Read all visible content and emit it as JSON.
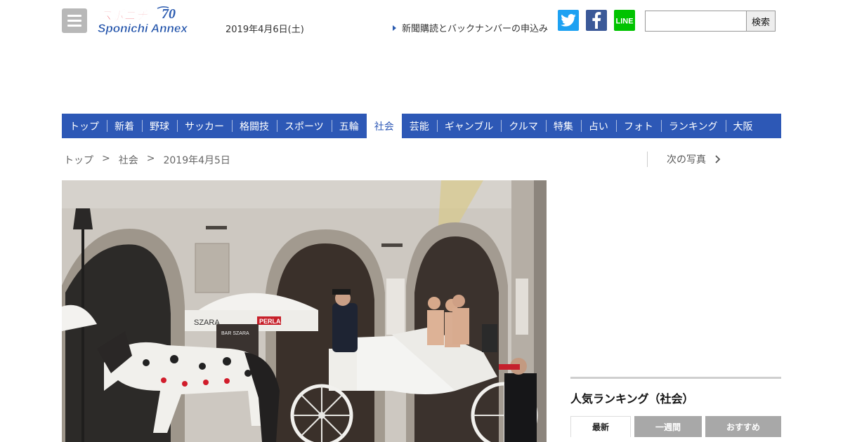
{
  "header": {
    "logo_text": "スポニチ",
    "logo_sub": "Sponichi Annex",
    "logo_anniv": "70",
    "date": "2019年4月6日(土)",
    "subscribe_link": "新聞購読とバックナンバーの申込み",
    "search_placeholder": "",
    "search_button": "検索",
    "line_label": "LINE"
  },
  "nav": [
    {
      "label": "トップ"
    },
    {
      "label": "新着"
    },
    {
      "label": "野球"
    },
    {
      "label": "サッカー"
    },
    {
      "label": "格闘技"
    },
    {
      "label": "スポーツ"
    },
    {
      "label": "五輪"
    },
    {
      "label": "社会",
      "active": true
    },
    {
      "label": "芸能"
    },
    {
      "label": "ギャンブル"
    },
    {
      "label": "クルマ"
    },
    {
      "label": "特集"
    },
    {
      "label": "占い"
    },
    {
      "label": "フォト"
    },
    {
      "label": "ランキング"
    },
    {
      "label": "大阪"
    }
  ],
  "breadcrumb": {
    "items": [
      "トップ",
      "社会",
      "2019年4月5日"
    ],
    "separator": ">"
  },
  "next_photo": "次の写真",
  "photo": {
    "signs": [
      "SZARA",
      "PERLA",
      "BAR SZARA",
      "BAR"
    ]
  },
  "ranking": {
    "title": "人気ランキング（社会）",
    "tabs": [
      "最新",
      "一週間",
      "おすすめ"
    ]
  },
  "colors": {
    "nav_bg": "#2d58b6",
    "twitter": "#1da1f2",
    "facebook": "#3b5998",
    "line": "#00c300"
  }
}
